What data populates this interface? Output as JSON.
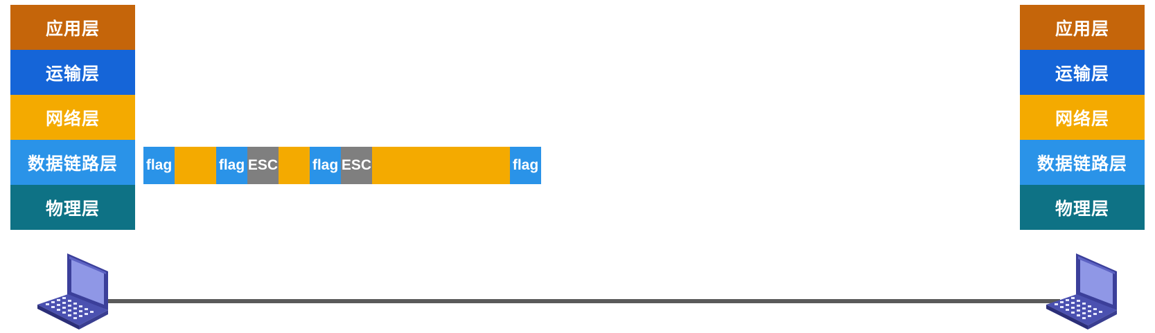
{
  "colors": {
    "application": "#c5650a",
    "transport": "#1565d8",
    "network": "#f4aa00",
    "datalink": "#2a93e8",
    "physical": "#0e7285",
    "frame_flag": "#2a93e8",
    "frame_esc": "#7f7f7f",
    "frame_data": "#f4aa00",
    "link": "#5a5a5a"
  },
  "stack_left": {
    "layers": [
      {
        "label": "应用层",
        "color_key": "application"
      },
      {
        "label": "运输层",
        "color_key": "transport"
      },
      {
        "label": "网络层",
        "color_key": "network"
      },
      {
        "label": "数据链路层",
        "color_key": "datalink"
      },
      {
        "label": "物理层",
        "color_key": "physical"
      }
    ]
  },
  "stack_right": {
    "layers": [
      {
        "label": "应用层",
        "color_key": "application"
      },
      {
        "label": "运输层",
        "color_key": "transport"
      },
      {
        "label": "网络层",
        "color_key": "network"
      },
      {
        "label": "数据链路层",
        "color_key": "datalink"
      },
      {
        "label": "物理层",
        "color_key": "physical"
      }
    ]
  },
  "frame": {
    "segments": [
      {
        "kind": "flag",
        "label": "flag"
      },
      {
        "kind": "data",
        "label": ""
      },
      {
        "kind": "flag",
        "label": "flag"
      },
      {
        "kind": "esc",
        "label": "ESC"
      },
      {
        "kind": "data",
        "label": ""
      },
      {
        "kind": "flag",
        "label": "flag"
      },
      {
        "kind": "esc",
        "label": "ESC"
      },
      {
        "kind": "data",
        "label": ""
      },
      {
        "kind": "flag",
        "label": "flag"
      }
    ]
  },
  "hosts": [
    {
      "icon": "laptop-icon"
    },
    {
      "icon": "laptop-icon"
    }
  ]
}
